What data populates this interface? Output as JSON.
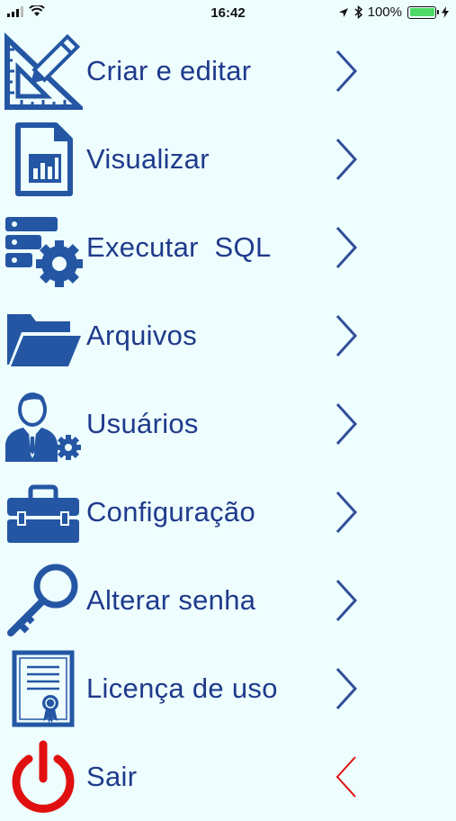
{
  "status_bar": {
    "time": "16:42",
    "battery": "100%"
  },
  "colors": {
    "background": "#eefdfd",
    "text": "#1f3a8c",
    "icon": "#2456a4",
    "chevron": "#2e4f9a",
    "exit": "#e01010"
  },
  "menu": {
    "items": [
      {
        "label": "Criar e editar",
        "icon": "ruler-pencil-icon"
      },
      {
        "label": "Visualizar",
        "icon": "report-chart-icon"
      },
      {
        "label": "Executar  SQL",
        "icon": "database-gear-icon"
      },
      {
        "label": "Arquivos",
        "icon": "folder-icon"
      },
      {
        "label": "Usuários",
        "icon": "user-gear-icon"
      },
      {
        "label": "Configuração",
        "icon": "toolbox-icon"
      },
      {
        "label": "Alterar senha",
        "icon": "key-icon"
      },
      {
        "label": "Licença de uso",
        "icon": "certificate-icon"
      },
      {
        "label": "Sair",
        "icon": "power-icon"
      }
    ]
  }
}
